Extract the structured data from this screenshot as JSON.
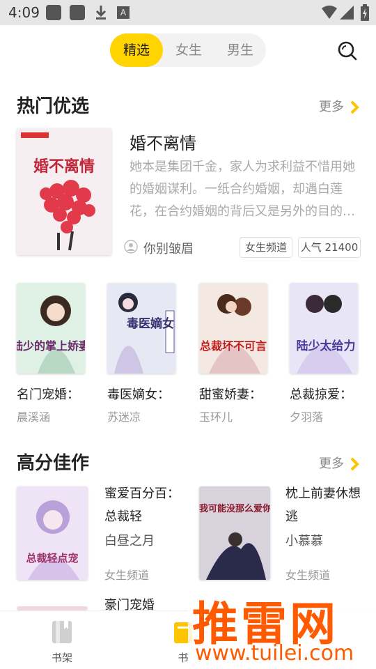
{
  "status_bar": {
    "time": "4:09"
  },
  "tabs": [
    {
      "label": "精选",
      "active": true
    },
    {
      "label": "女生",
      "active": false
    },
    {
      "label": "男生",
      "active": false
    }
  ],
  "hot": {
    "title": "热门优选",
    "more": "更多",
    "featured": {
      "title": "婚不离情",
      "description": "她本是集团千金，家人为求利益不惜用她的婚姻谋利。一纸合约婚姻，却遇白莲花，在合约婚姻的背后又是另外的目的…",
      "author": "你别皱眉",
      "channel": "女生频道",
      "popularity": "人气 21400",
      "cover_text": "婚不离情"
    },
    "grid": [
      {
        "title": "名门宠婚：",
        "author": "晨溪涵",
        "cover_text": "陆少的掌上娇妻"
      },
      {
        "title": "毒医嫡女：",
        "author": "苏迷凉",
        "cover_text": "毒医嫡女"
      },
      {
        "title": "甜蜜娇妻：",
        "author": "玉环儿",
        "cover_text": "总裁坏不可言"
      },
      {
        "title": "总裁掠爱：",
        "author": "夕羽落",
        "cover_text": "陆少太给力"
      }
    ]
  },
  "high_score": {
    "title": "高分佳作",
    "more": "更多",
    "items": [
      {
        "title": "蜜爱百分百：总裁轻",
        "author": "白昼之月",
        "channel": "女生频道",
        "cover_text": "总裁轻点宠"
      },
      {
        "title": "枕上前妻休想逃",
        "author": "小慕慕",
        "channel": "女生频道",
        "cover_text": "我可能没那么爱你"
      }
    ],
    "partial_title": "豪门宠婚"
  },
  "bottom_nav": [
    {
      "label": "书架"
    },
    {
      "label": "书"
    }
  ],
  "watermark": {
    "main": "推雷网",
    "sub": "www.tuilei.com"
  },
  "colors": {
    "accent": "#ffd400",
    "watermark": "#ff5a00"
  }
}
